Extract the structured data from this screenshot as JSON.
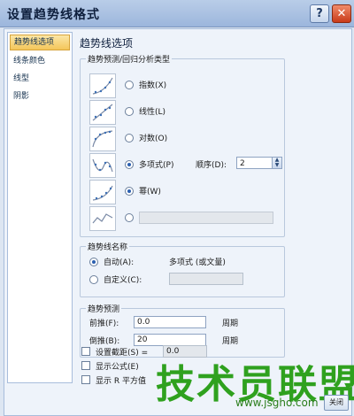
{
  "window": {
    "title": "设置趋势线格式",
    "help_icon": "question-icon",
    "close_icon": "close-icon"
  },
  "nav": {
    "items": [
      "趋势线选项",
      "线条颜色",
      "线型",
      "阴影"
    ],
    "selected_index": 0
  },
  "pane": {
    "title": "趋势线选项",
    "type_group": {
      "label": "趋势预测/回归分析类型",
      "options": [
        {
          "label": "指数(X)",
          "selected": false,
          "icon": "exponential-trend-icon"
        },
        {
          "label": "线性(L)",
          "selected": false,
          "icon": "linear-trend-icon"
        },
        {
          "label": "对数(O)",
          "selected": false,
          "icon": "logarithmic-trend-icon"
        },
        {
          "label": "多项式(P)",
          "selected": true,
          "icon": "polynomial-trend-icon"
        },
        {
          "label": "幂(W)",
          "selected": true,
          "icon": "power-trend-icon"
        },
        {
          "label": "",
          "selected": false,
          "icon": "moving-average-trend-icon"
        }
      ],
      "order_label": "顺序(D):",
      "order_value": "2"
    },
    "name_group": {
      "label": "趋势线名称",
      "auto_label": "自动(A):",
      "auto_value": "多项式 (或文量)",
      "custom_label": "自定义(C):",
      "selected": "auto"
    },
    "forecast_group": {
      "label": "趋势预测",
      "forward_label": "前推(F):",
      "forward_value": "0.0",
      "backward_label": "倒推(B):",
      "backward_value": "20",
      "unit": "周期"
    },
    "checks": [
      {
        "label": "设置截距(S) =",
        "checked": false,
        "value": "0.0"
      },
      {
        "label": "显示公式(E)",
        "checked": false
      },
      {
        "label": "显示 R 平方值",
        "checked": false
      }
    ]
  },
  "footer": {
    "close_label": "关闭"
  },
  "watermark": {
    "text": "技术员联盟",
    "url": "www.jsgho.com"
  }
}
